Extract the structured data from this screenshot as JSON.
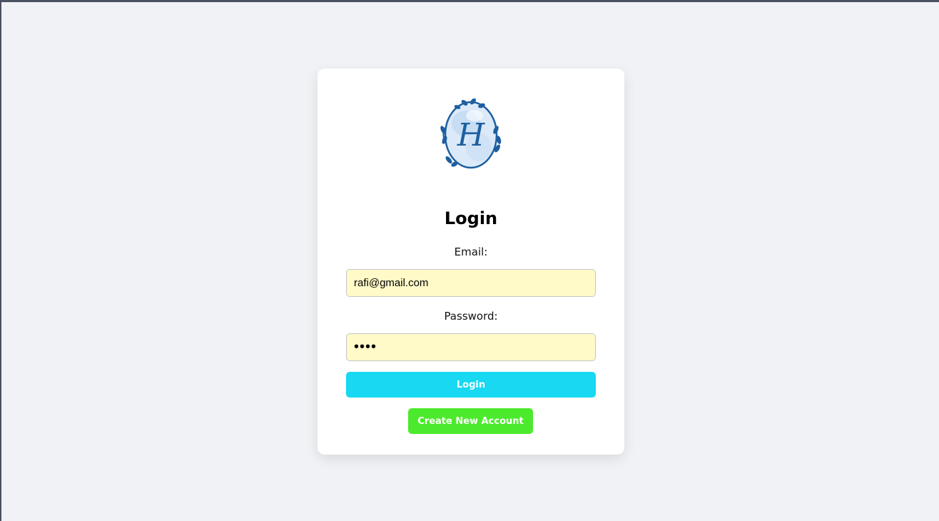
{
  "login_card": {
    "logo_icon": "monogram-h-logo-icon",
    "logo_letter": "H",
    "title": "Login",
    "email_label": "Email:",
    "email_value": "rafi@gmail.com",
    "password_label": "Password:",
    "password_value": "••••",
    "login_button": "Login",
    "create_account_button": "Create New Account"
  },
  "colors": {
    "page_background": "#f0f2f5",
    "card_background": "#ffffff",
    "input_background": "#fffac8",
    "login_button": "#18d8f2",
    "create_account_button": "#4cea2c",
    "logo_blue": "#1d5fa0"
  }
}
